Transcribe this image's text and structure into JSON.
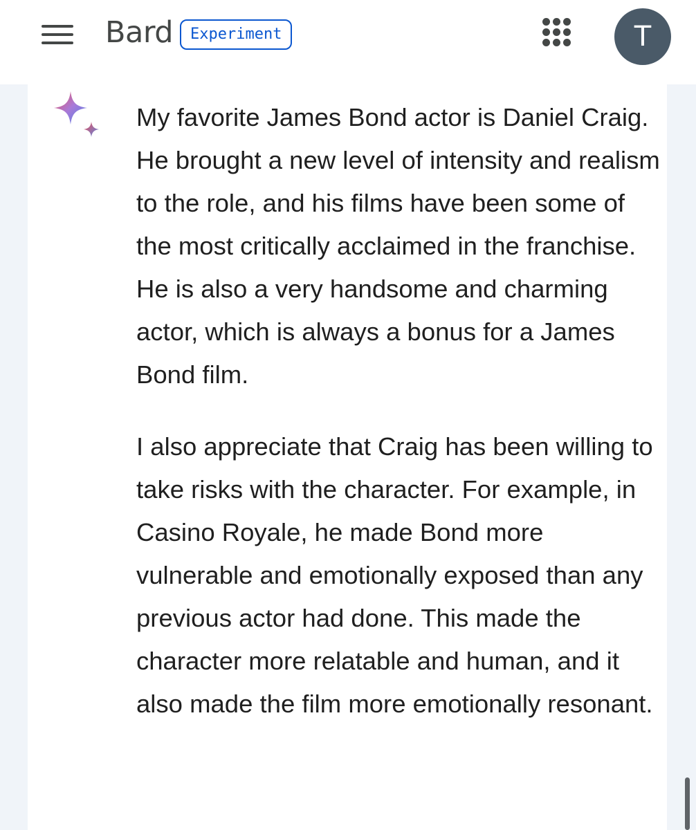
{
  "header": {
    "brand": "Bard",
    "badge": "Experiment",
    "avatar_initial": "T",
    "menu_icon": "hamburger-menu-icon",
    "apps_icon": "apps-grid-icon"
  },
  "response": {
    "icon": "bard-sparkle-icon",
    "paragraphs": [
      "My favorite James Bond actor is Daniel Craig. He brought a new level of intensity and realism to the role, and his films have been some of the most critically acclaimed in the franchise. He is also a very handsome and charming actor, which is always a bonus for a James Bond film.",
      "I also appreciate that Craig has been willing to take risks with the character. For example, in Casino Royale, he made Bond more vulnerable and emotionally exposed than any previous actor had done. This made the character more relatable and human, and it also made the film more emotionally resonant."
    ]
  },
  "colors": {
    "accent": "#0b57d0",
    "avatar_bg": "#4a5a68",
    "text": "#1f1f1f",
    "background": "#f0f4f9"
  }
}
